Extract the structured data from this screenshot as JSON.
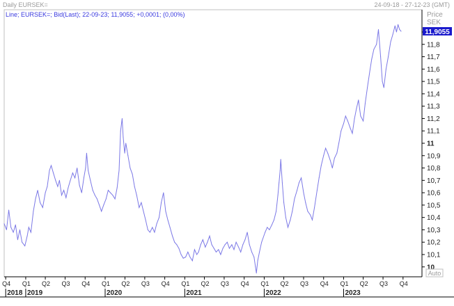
{
  "header": {
    "title": "Daily EURSEK=",
    "date_range": "24-09-18 - 27-12-23 (GMT)"
  },
  "legend": {
    "text": "Line; EURSEK=; Bid(Last); 22-09-23; 11,9055; +0,0001; (0,00%)"
  },
  "y_axis": {
    "title_line1": "Price",
    "title_line2": "SEK",
    "auto_label": "Auto"
  },
  "last_value_label": "11,9055",
  "colors": {
    "line": "#7b78e6",
    "last_badge": "#1a1acc",
    "axis": "#000000"
  },
  "chart_data": {
    "type": "line",
    "title": "Daily EURSEK=",
    "ylabel": "Price SEK",
    "ylim": [
      9.92,
      12.08
    ],
    "xlim": [
      "2018-09-24",
      "2023-12-27"
    ],
    "y_ticks": [
      {
        "value": 10.0,
        "label": "10",
        "bold": true
      },
      {
        "value": 10.1,
        "label": "10,1"
      },
      {
        "value": 10.2,
        "label": "10,2"
      },
      {
        "value": 10.3,
        "label": "10,3"
      },
      {
        "value": 10.4,
        "label": "10,4"
      },
      {
        "value": 10.5,
        "label": "10,5"
      },
      {
        "value": 10.6,
        "label": "10,6"
      },
      {
        "value": 10.7,
        "label": "10,7"
      },
      {
        "value": 10.8,
        "label": "10,8"
      },
      {
        "value": 10.9,
        "label": "10,9"
      },
      {
        "value": 11.0,
        "label": "11",
        "bold": true
      },
      {
        "value": 11.1,
        "label": "11,1"
      },
      {
        "value": 11.2,
        "label": "11,2"
      },
      {
        "value": 11.3,
        "label": "11,3"
      },
      {
        "value": 11.4,
        "label": "11,4"
      },
      {
        "value": 11.5,
        "label": "11,5"
      },
      {
        "value": 11.6,
        "label": "11,6"
      },
      {
        "value": 11.7,
        "label": "11,7"
      },
      {
        "value": 11.8,
        "label": "11,8"
      },
      {
        "value": 11.9,
        "label": "11,9"
      }
    ],
    "x_quarter_ticks": [
      {
        "date": "2018-10-01",
        "label": "Q4"
      },
      {
        "date": "2019-01-01",
        "label": "Q1"
      },
      {
        "date": "2019-04-01",
        "label": "Q2"
      },
      {
        "date": "2019-07-01",
        "label": "Q3"
      },
      {
        "date": "2019-10-01",
        "label": "Q4"
      },
      {
        "date": "2020-01-01",
        "label": "Q1"
      },
      {
        "date": "2020-04-01",
        "label": "Q2"
      },
      {
        "date": "2020-07-01",
        "label": "Q3"
      },
      {
        "date": "2020-10-01",
        "label": "Q4"
      },
      {
        "date": "2021-01-01",
        "label": "Q1"
      },
      {
        "date": "2021-04-01",
        "label": "Q2"
      },
      {
        "date": "2021-07-01",
        "label": "Q3"
      },
      {
        "date": "2021-10-01",
        "label": "Q4"
      },
      {
        "date": "2022-01-01",
        "label": "Q1"
      },
      {
        "date": "2022-04-01",
        "label": "Q2"
      },
      {
        "date": "2022-07-01",
        "label": "Q3"
      },
      {
        "date": "2022-10-01",
        "label": "Q4"
      },
      {
        "date": "2023-01-01",
        "label": "Q1"
      },
      {
        "date": "2023-04-01",
        "label": "Q2"
      },
      {
        "date": "2023-07-01",
        "label": "Q3"
      },
      {
        "date": "2023-10-01",
        "label": "Q4"
      }
    ],
    "x_year_ticks": [
      {
        "date": "2018-10-01",
        "label": "2018"
      },
      {
        "date": "2019-01-01",
        "label": "2019"
      },
      {
        "date": "2020-01-01",
        "label": "2020"
      },
      {
        "date": "2021-01-01",
        "label": "2021"
      },
      {
        "date": "2022-01-01",
        "label": "2022"
      },
      {
        "date": "2023-01-01",
        "label": "2023"
      }
    ],
    "series": [
      {
        "points": [
          [
            "2018-09-24",
            10.35
          ],
          [
            "2018-10-05",
            10.3
          ],
          [
            "2018-10-15",
            10.46
          ],
          [
            "2018-10-25",
            10.32
          ],
          [
            "2018-11-05",
            10.28
          ],
          [
            "2018-11-15",
            10.34
          ],
          [
            "2018-11-25",
            10.22
          ],
          [
            "2018-12-05",
            10.3
          ],
          [
            "2018-12-15",
            10.2
          ],
          [
            "2018-12-28",
            10.17
          ],
          [
            "2019-01-08",
            10.25
          ],
          [
            "2019-01-15",
            10.32
          ],
          [
            "2019-01-25",
            10.28
          ],
          [
            "2019-02-05",
            10.45
          ],
          [
            "2019-02-15",
            10.55
          ],
          [
            "2019-02-25",
            10.62
          ],
          [
            "2019-03-08",
            10.52
          ],
          [
            "2019-03-20",
            10.48
          ],
          [
            "2019-04-01",
            10.6
          ],
          [
            "2019-04-10",
            10.65
          ],
          [
            "2019-04-20",
            10.78
          ],
          [
            "2019-04-28",
            10.82
          ],
          [
            "2019-05-08",
            10.76
          ],
          [
            "2019-05-18",
            10.7
          ],
          [
            "2019-05-28",
            10.65
          ],
          [
            "2019-06-05",
            10.7
          ],
          [
            "2019-06-15",
            10.58
          ],
          [
            "2019-06-25",
            10.62
          ],
          [
            "2019-07-05",
            10.56
          ],
          [
            "2019-07-15",
            10.64
          ],
          [
            "2019-07-25",
            10.7
          ],
          [
            "2019-08-05",
            10.76
          ],
          [
            "2019-08-15",
            10.72
          ],
          [
            "2019-08-25",
            10.8
          ],
          [
            "2019-09-05",
            10.66
          ],
          [
            "2019-09-15",
            10.6
          ],
          [
            "2019-09-25",
            10.72
          ],
          [
            "2019-10-03",
            10.8
          ],
          [
            "2019-10-08",
            10.92
          ],
          [
            "2019-10-15",
            10.78
          ],
          [
            "2019-10-25",
            10.7
          ],
          [
            "2019-11-05",
            10.62
          ],
          [
            "2019-11-15",
            10.58
          ],
          [
            "2019-11-25",
            10.55
          ],
          [
            "2019-12-05",
            10.5
          ],
          [
            "2019-12-15",
            10.45
          ],
          [
            "2019-12-25",
            10.5
          ],
          [
            "2020-01-05",
            10.55
          ],
          [
            "2020-01-15",
            10.62
          ],
          [
            "2020-01-25",
            10.6
          ],
          [
            "2020-02-05",
            10.58
          ],
          [
            "2020-02-15",
            10.55
          ],
          [
            "2020-02-25",
            10.64
          ],
          [
            "2020-03-05",
            10.78
          ],
          [
            "2020-03-12",
            11.1
          ],
          [
            "2020-03-19",
            11.2
          ],
          [
            "2020-03-24",
            11.05
          ],
          [
            "2020-03-31",
            10.92
          ],
          [
            "2020-04-05",
            11.0
          ],
          [
            "2020-04-15",
            10.9
          ],
          [
            "2020-04-25",
            10.8
          ],
          [
            "2020-05-05",
            10.75
          ],
          [
            "2020-05-15",
            10.65
          ],
          [
            "2020-05-25",
            10.58
          ],
          [
            "2020-06-05",
            10.48
          ],
          [
            "2020-06-15",
            10.52
          ],
          [
            "2020-06-25",
            10.45
          ],
          [
            "2020-07-05",
            10.38
          ],
          [
            "2020-07-15",
            10.3
          ],
          [
            "2020-07-25",
            10.28
          ],
          [
            "2020-08-05",
            10.32
          ],
          [
            "2020-08-15",
            10.28
          ],
          [
            "2020-08-25",
            10.35
          ],
          [
            "2020-09-05",
            10.4
          ],
          [
            "2020-09-15",
            10.52
          ],
          [
            "2020-09-25",
            10.6
          ],
          [
            "2020-10-05",
            10.45
          ],
          [
            "2020-10-15",
            10.38
          ],
          [
            "2020-10-25",
            10.32
          ],
          [
            "2020-11-05",
            10.25
          ],
          [
            "2020-11-15",
            10.2
          ],
          [
            "2020-11-25",
            10.18
          ],
          [
            "2020-12-05",
            10.15
          ],
          [
            "2020-12-15",
            10.1
          ],
          [
            "2020-12-25",
            10.07
          ],
          [
            "2021-01-05",
            10.08
          ],
          [
            "2021-01-15",
            10.12
          ],
          [
            "2021-01-25",
            10.08
          ],
          [
            "2021-02-05",
            10.05
          ],
          [
            "2021-02-15",
            10.14
          ],
          [
            "2021-02-25",
            10.1
          ],
          [
            "2021-03-05",
            10.12
          ],
          [
            "2021-03-15",
            10.18
          ],
          [
            "2021-03-25",
            10.22
          ],
          [
            "2021-04-05",
            10.16
          ],
          [
            "2021-04-15",
            10.2
          ],
          [
            "2021-04-25",
            10.25
          ],
          [
            "2021-05-05",
            10.18
          ],
          [
            "2021-05-15",
            10.15
          ],
          [
            "2021-05-25",
            10.12
          ],
          [
            "2021-06-05",
            10.14
          ],
          [
            "2021-06-15",
            10.1
          ],
          [
            "2021-06-25",
            10.15
          ],
          [
            "2021-07-05",
            10.18
          ],
          [
            "2021-07-15",
            10.2
          ],
          [
            "2021-07-25",
            10.15
          ],
          [
            "2021-08-05",
            10.18
          ],
          [
            "2021-08-15",
            10.14
          ],
          [
            "2021-08-25",
            10.2
          ],
          [
            "2021-09-05",
            10.16
          ],
          [
            "2021-09-15",
            10.12
          ],
          [
            "2021-09-25",
            10.18
          ],
          [
            "2021-10-05",
            10.22
          ],
          [
            "2021-10-15",
            10.28
          ],
          [
            "2021-10-25",
            10.18
          ],
          [
            "2021-11-05",
            10.12
          ],
          [
            "2021-11-15",
            10.08
          ],
          [
            "2021-11-22",
            10.0
          ],
          [
            "2021-11-26",
            9.95
          ],
          [
            "2021-12-02",
            10.05
          ],
          [
            "2021-12-10",
            10.12
          ],
          [
            "2021-12-20",
            10.2
          ],
          [
            "2022-01-05",
            10.28
          ],
          [
            "2022-01-15",
            10.32
          ],
          [
            "2022-01-25",
            10.3
          ],
          [
            "2022-02-05",
            10.34
          ],
          [
            "2022-02-15",
            10.38
          ],
          [
            "2022-02-25",
            10.45
          ],
          [
            "2022-03-05",
            10.58
          ],
          [
            "2022-03-10",
            10.68
          ],
          [
            "2022-03-15",
            10.78
          ],
          [
            "2022-03-18",
            10.87
          ],
          [
            "2022-03-25",
            10.68
          ],
          [
            "2022-04-01",
            10.52
          ],
          [
            "2022-04-10",
            10.4
          ],
          [
            "2022-04-20",
            10.32
          ],
          [
            "2022-05-01",
            10.38
          ],
          [
            "2022-05-10",
            10.45
          ],
          [
            "2022-05-20",
            10.55
          ],
          [
            "2022-06-01",
            10.62
          ],
          [
            "2022-06-10",
            10.68
          ],
          [
            "2022-06-20",
            10.72
          ],
          [
            "2022-07-01",
            10.6
          ],
          [
            "2022-07-10",
            10.52
          ],
          [
            "2022-07-20",
            10.45
          ],
          [
            "2022-08-01",
            10.42
          ],
          [
            "2022-08-10",
            10.38
          ],
          [
            "2022-08-20",
            10.48
          ],
          [
            "2022-09-01",
            10.62
          ],
          [
            "2022-09-10",
            10.72
          ],
          [
            "2022-09-20",
            10.82
          ],
          [
            "2022-10-01",
            10.9
          ],
          [
            "2022-10-10",
            10.96
          ],
          [
            "2022-10-20",
            10.92
          ],
          [
            "2022-11-01",
            10.86
          ],
          [
            "2022-11-10",
            10.8
          ],
          [
            "2022-11-20",
            10.88
          ],
          [
            "2022-12-01",
            10.92
          ],
          [
            "2022-12-10",
            11.0
          ],
          [
            "2022-12-20",
            11.1
          ],
          [
            "2023-01-01",
            11.16
          ],
          [
            "2023-01-10",
            11.22
          ],
          [
            "2023-01-20",
            11.18
          ],
          [
            "2023-02-01",
            11.12
          ],
          [
            "2023-02-10",
            11.08
          ],
          [
            "2023-02-20",
            11.2
          ],
          [
            "2023-03-01",
            11.28
          ],
          [
            "2023-03-10",
            11.35
          ],
          [
            "2023-03-20",
            11.22
          ],
          [
            "2023-04-01",
            11.18
          ],
          [
            "2023-04-10",
            11.32
          ],
          [
            "2023-04-20",
            11.45
          ],
          [
            "2023-05-01",
            11.58
          ],
          [
            "2023-05-10",
            11.68
          ],
          [
            "2023-05-20",
            11.76
          ],
          [
            "2023-06-01",
            11.8
          ],
          [
            "2023-06-10",
            11.92
          ],
          [
            "2023-06-20",
            11.7
          ],
          [
            "2023-06-28",
            11.5
          ],
          [
            "2023-07-05",
            11.45
          ],
          [
            "2023-07-15",
            11.6
          ],
          [
            "2023-07-25",
            11.7
          ],
          [
            "2023-08-05",
            11.82
          ],
          [
            "2023-08-15",
            11.88
          ],
          [
            "2023-08-25",
            11.95
          ],
          [
            "2023-09-01",
            11.9
          ],
          [
            "2023-09-08",
            11.96
          ],
          [
            "2023-09-15",
            11.92
          ],
          [
            "2023-09-22",
            11.9055
          ]
        ]
      }
    ]
  }
}
